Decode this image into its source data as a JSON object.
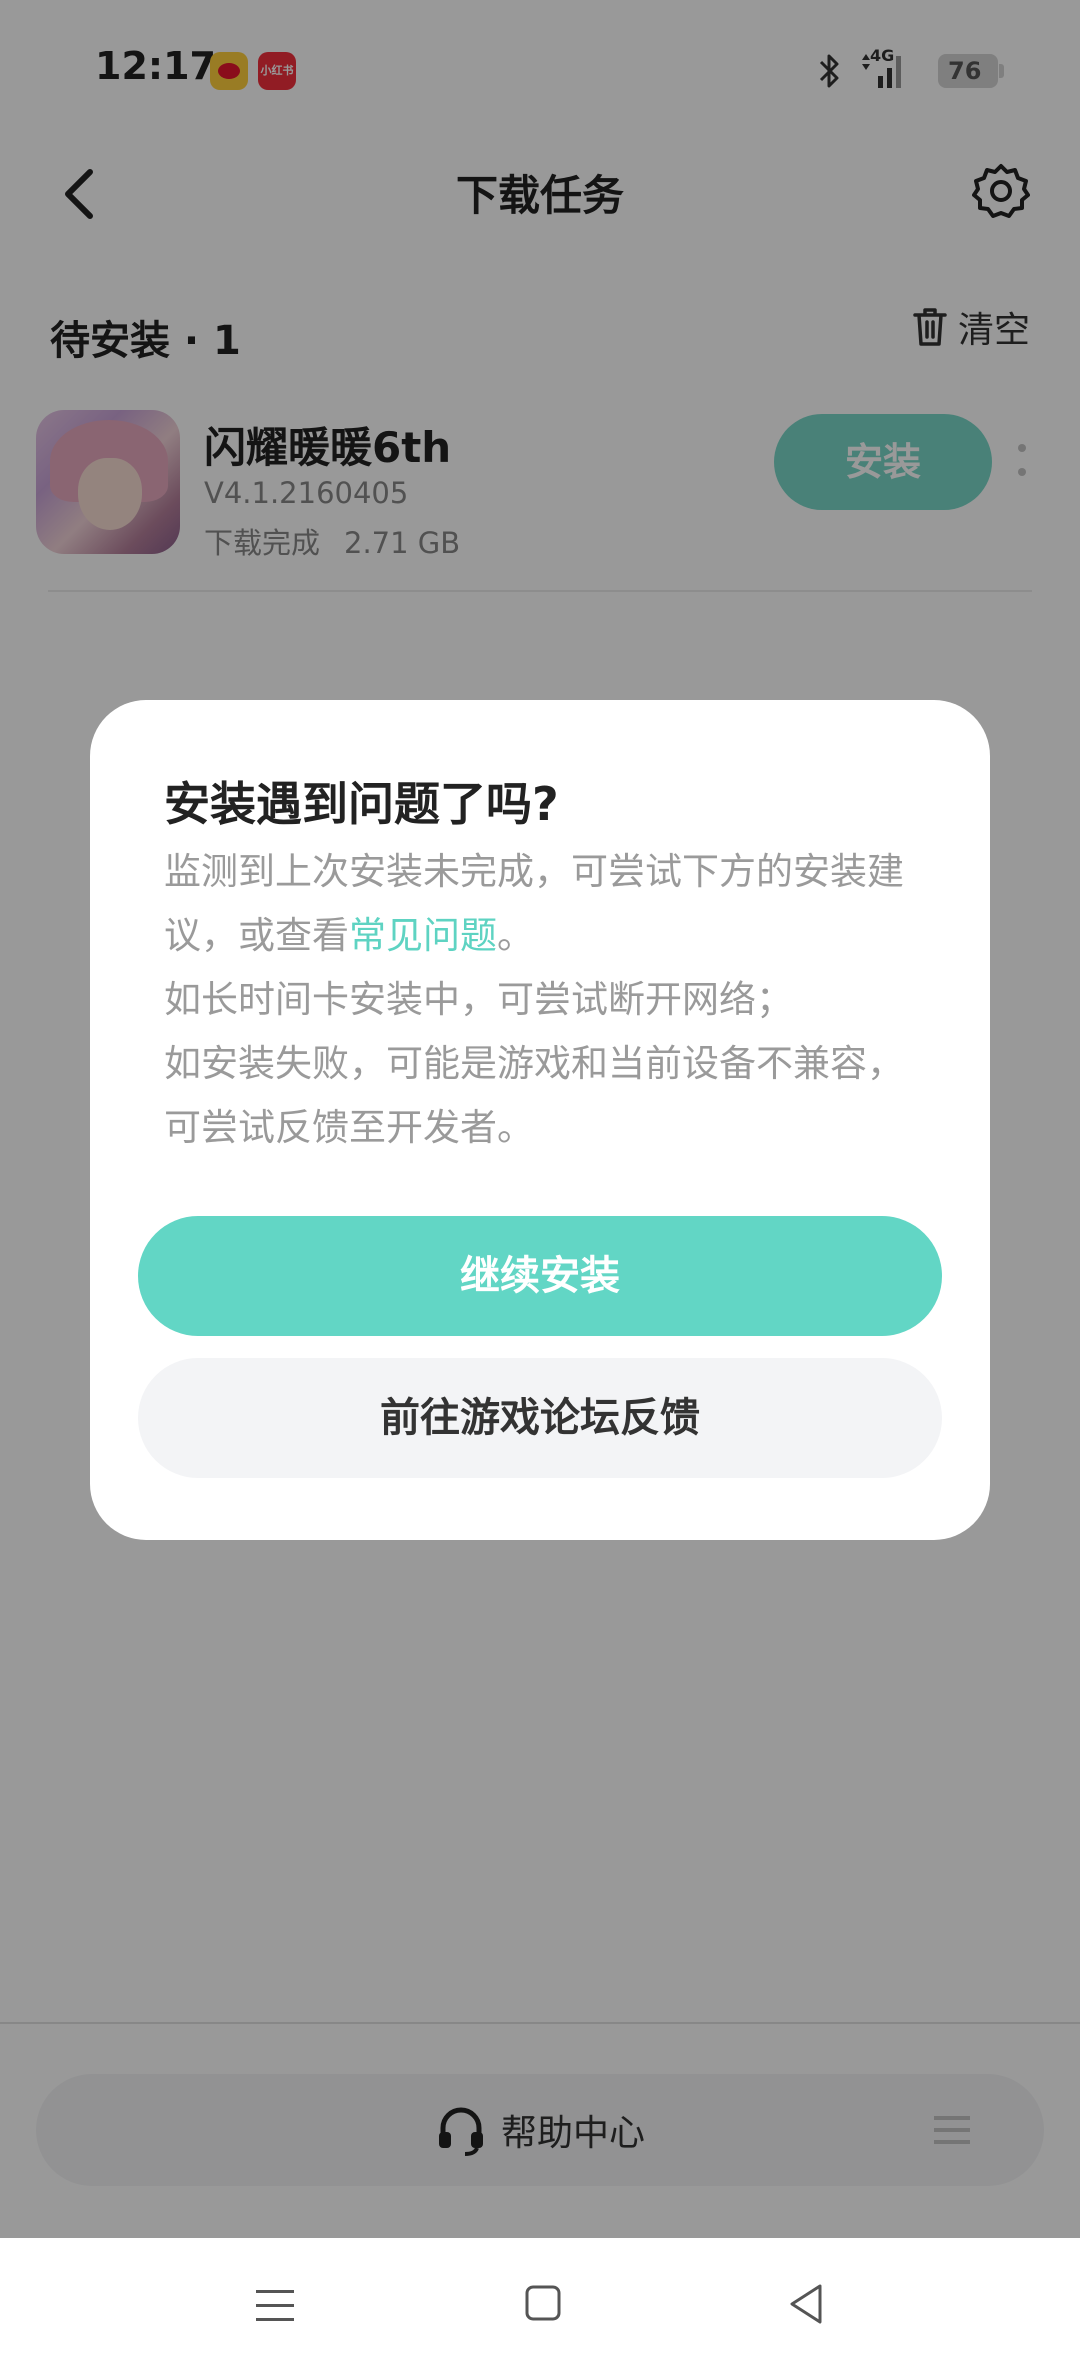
{
  "status_bar": {
    "time": "12:17",
    "notification_badge": "小红书",
    "network": "4G",
    "battery": "76"
  },
  "header": {
    "title": "下载任务"
  },
  "section": {
    "title": "待安装 · 1",
    "clear_label": "清空"
  },
  "item": {
    "name": "闪耀暖暖6th",
    "version": "V4.1.2160405",
    "status": "下载完成",
    "size": "2.71 GB",
    "install_label": "安装"
  },
  "dialog": {
    "title": "安装遇到问题了吗?",
    "body_part1": "监测到上次安装未完成，可尝试下方的安装建议，或查看",
    "faq_link": "常见问题",
    "body_part2": "。",
    "body_line3": "如长时间卡安装中，可尝试断开网络；",
    "body_line4": "如安装失败，可能是游戏和当前设备不兼容，可尝试反馈至开发者。",
    "continue_label": "继续安装",
    "forum_label": "前往游戏论坛反馈"
  },
  "bottom": {
    "help_label": "帮助中心"
  },
  "colors": {
    "accent": "#62d6c5",
    "link": "#5ed3c2"
  }
}
